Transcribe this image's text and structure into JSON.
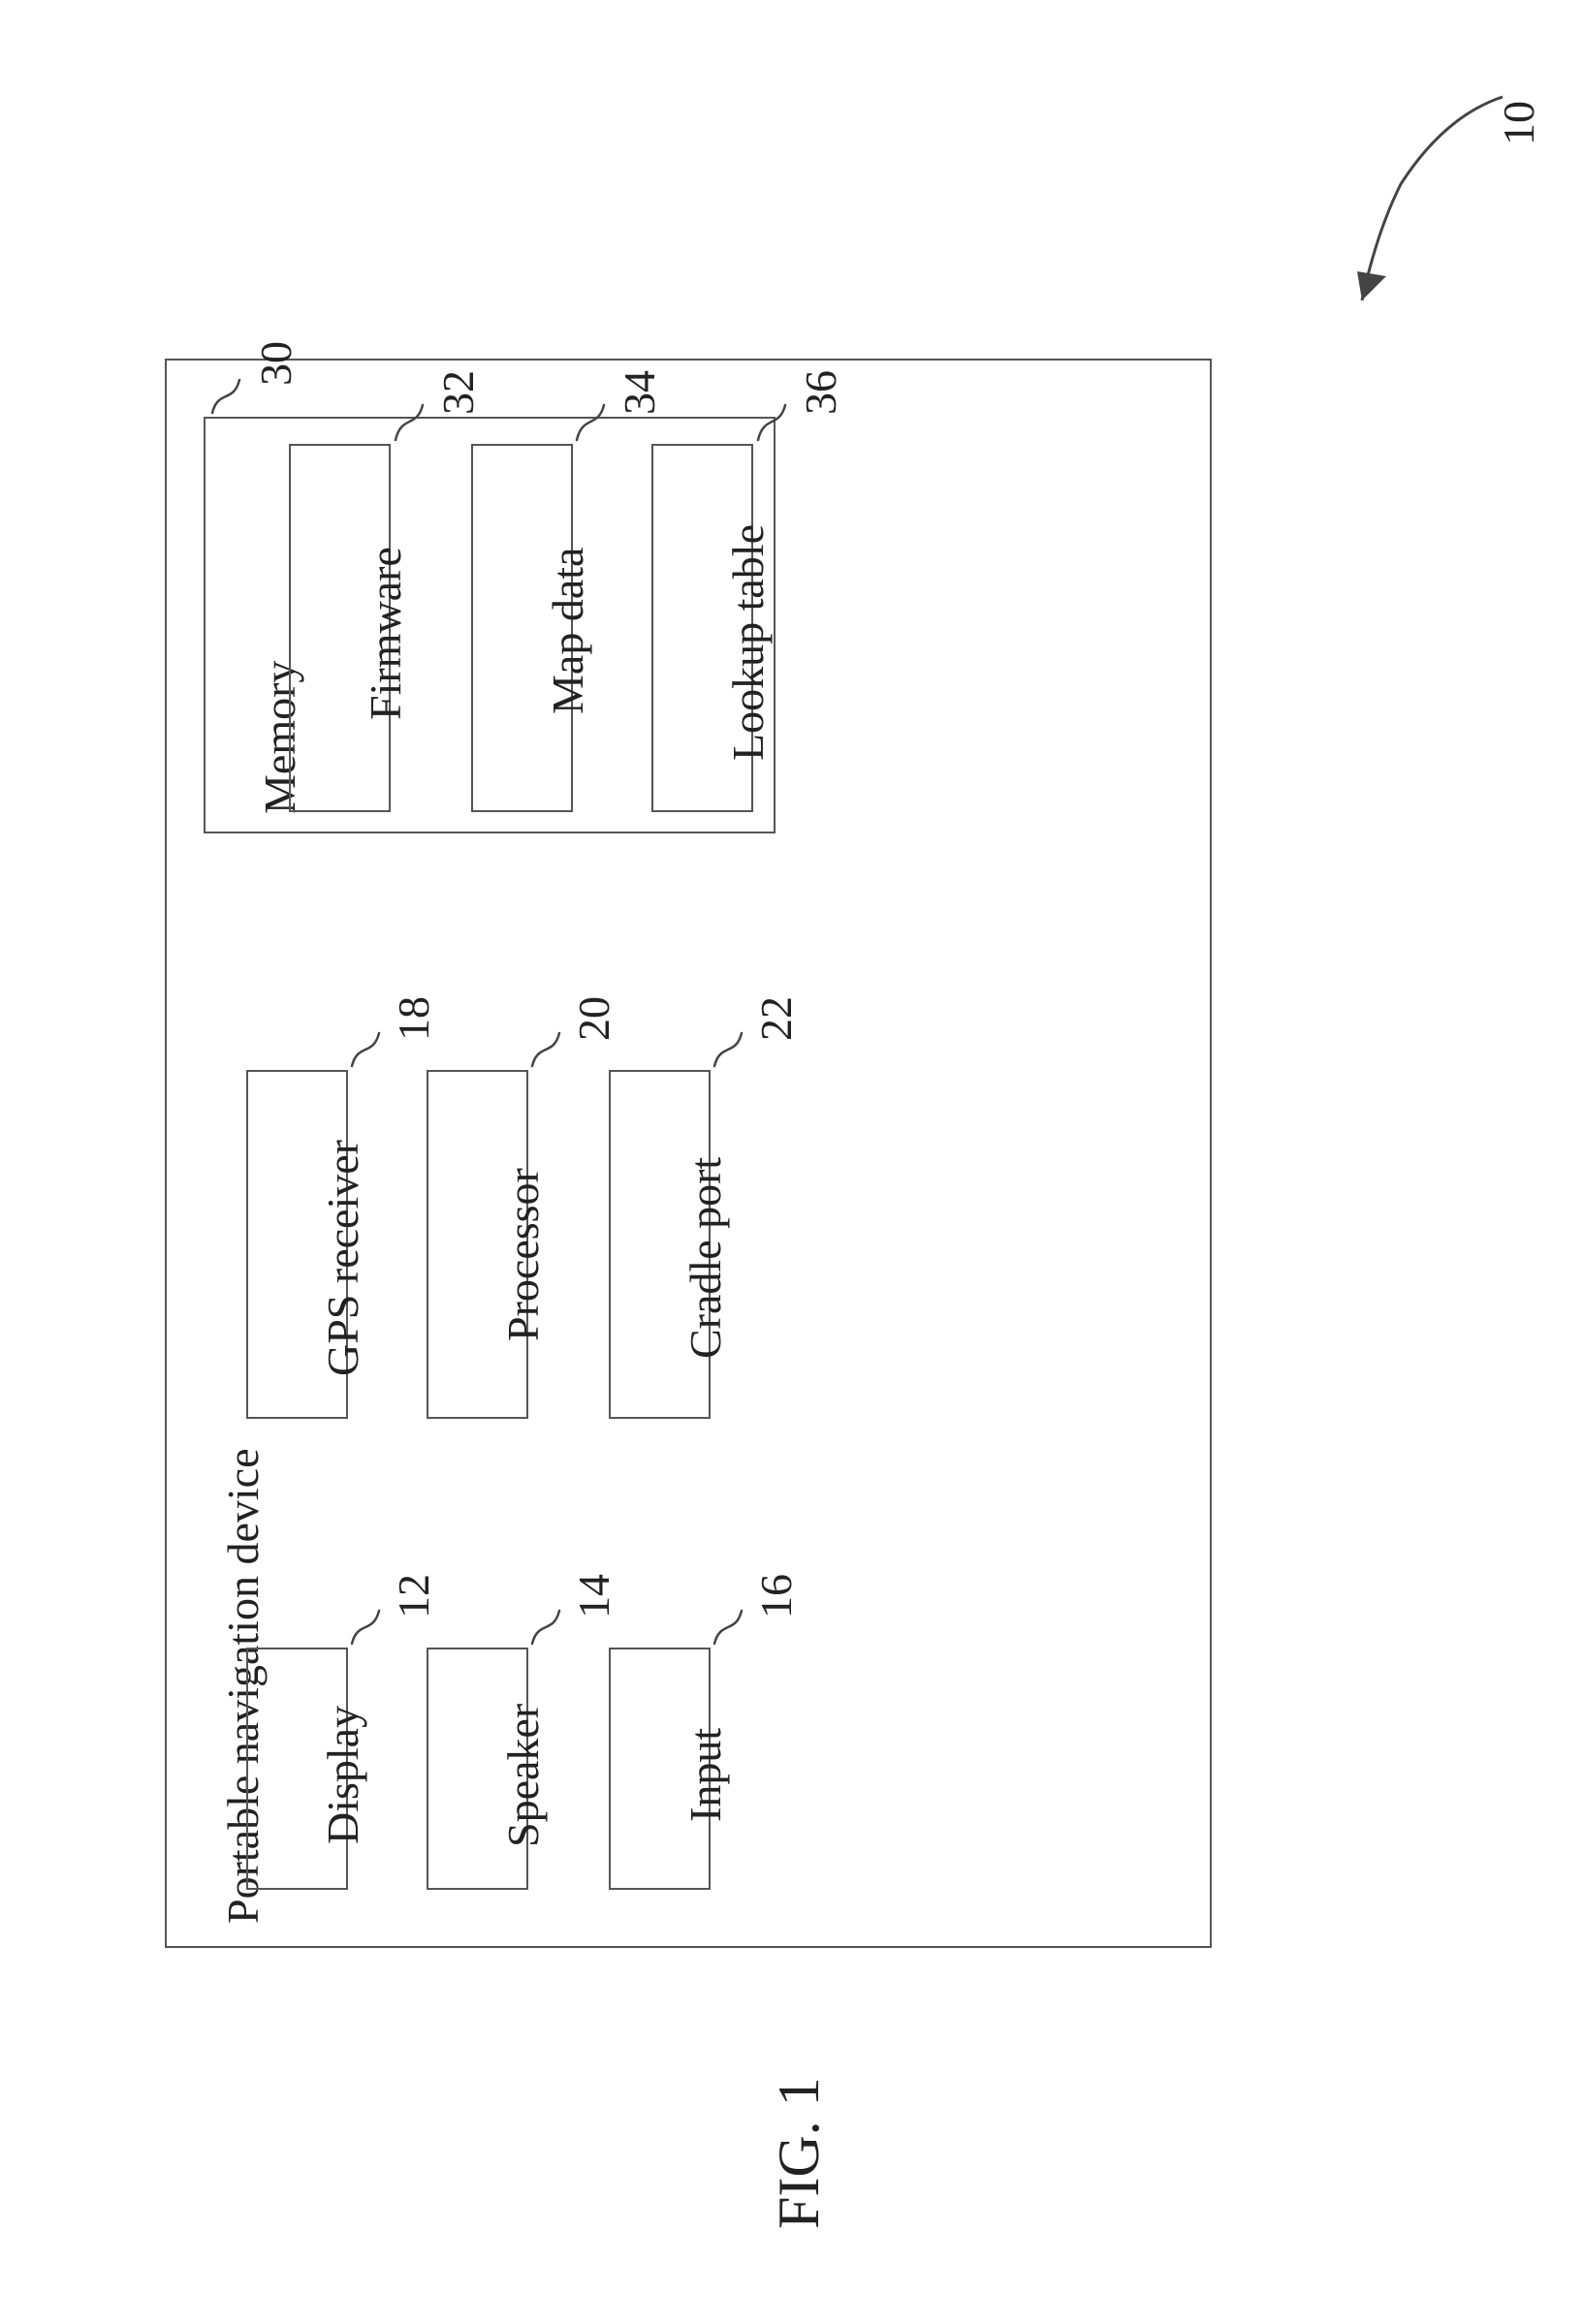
{
  "figure_ref": "10",
  "device_title": "Portable navigation device",
  "blocks": {
    "display": {
      "label": "Display",
      "ref": "12"
    },
    "speaker": {
      "label": "Speaker",
      "ref": "14"
    },
    "input": {
      "label": "Input",
      "ref": "16"
    },
    "gps": {
      "label": "GPS receiver",
      "ref": "18"
    },
    "processor": {
      "label": "Processor",
      "ref": "20"
    },
    "cradle": {
      "label": "Cradle port",
      "ref": "22"
    }
  },
  "memory": {
    "title": "Memory",
    "ref": "30",
    "items": {
      "firmware": {
        "label": "Firmware",
        "ref": "32"
      },
      "mapdata": {
        "label": "Map data",
        "ref": "34"
      },
      "lookup": {
        "label": "Lookup table",
        "ref": "36"
      }
    }
  },
  "figure_label": "FIG. 1"
}
